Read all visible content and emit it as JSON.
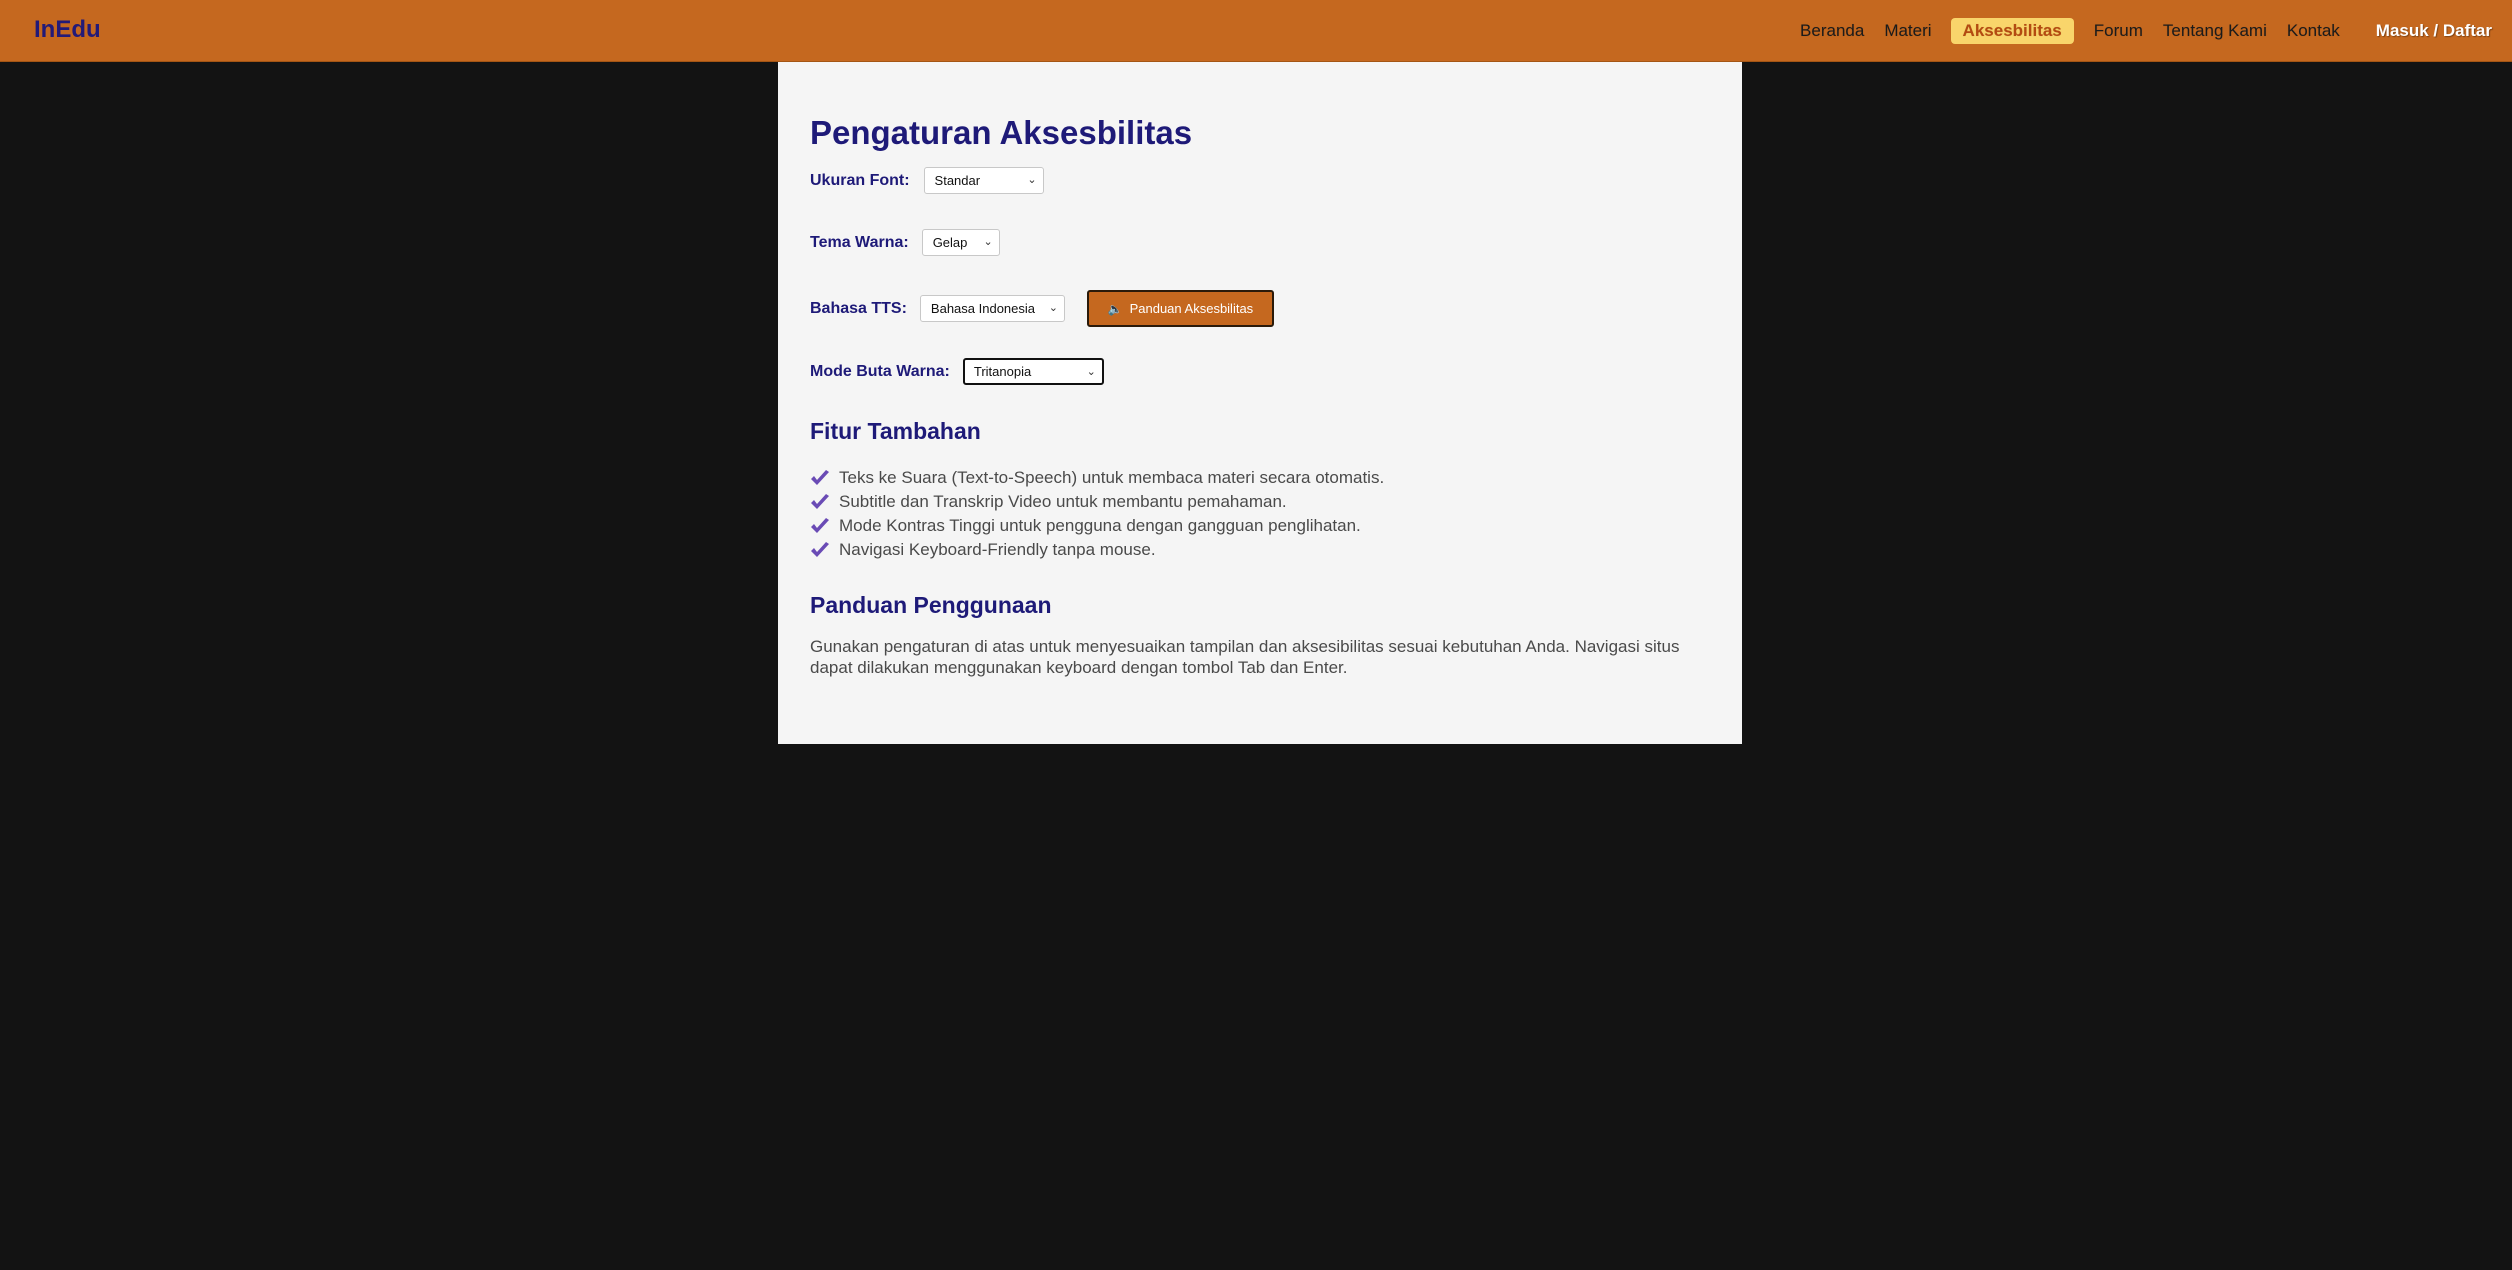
{
  "nav": {
    "brand": "InEdu",
    "links": [
      "Beranda",
      "Materi",
      "Aksesbilitas",
      "Forum",
      "Tentang Kami",
      "Kontak"
    ],
    "active": "Aksesbilitas",
    "auth": "Masuk / Daftar"
  },
  "settings": {
    "title": "Pengaturan Aksesbilitas",
    "font_size": {
      "label": "Ukuran Font:",
      "value": "Standar"
    },
    "theme": {
      "label": "Tema Warna:",
      "value": "Gelap"
    },
    "tts": {
      "label": "Bahasa TTS:",
      "value": "Bahasa Indonesia"
    },
    "guide_button": {
      "icon": "speaker-icon",
      "label": "Panduan Aksesbilitas"
    },
    "colorblind": {
      "label": "Mode Buta Warna:",
      "value": "Tritanopia"
    }
  },
  "features": {
    "title": "Fitur Tambahan",
    "items": [
      "Teks ke Suara (Text-to-Speech) untuk membaca materi secara otomatis.",
      "Subtitle dan Transkrip Video untuk membantu pemahaman.",
      "Mode Kontras Tinggi untuk pengguna dengan gangguan penglihatan.",
      "Navigasi Keyboard-Friendly tanpa mouse."
    ]
  },
  "guide": {
    "title": "Panduan Penggunaan",
    "text": "Gunakan pengaturan di atas untuk menyesuaikan tampilan dan aksesibilitas sesuai kebutuhan Anda. Navigasi situs dapat dilakukan menggunakan keyboard dengan tombol Tab dan Enter."
  },
  "colors": {
    "nav_bg": "#c5681f",
    "brand": "#231a78",
    "active_bg": "#f9d56b",
    "heading": "#1e1a78",
    "check": "#6a4bb5",
    "page_bg": "#131313",
    "panel_bg": "#f5f5f5"
  }
}
